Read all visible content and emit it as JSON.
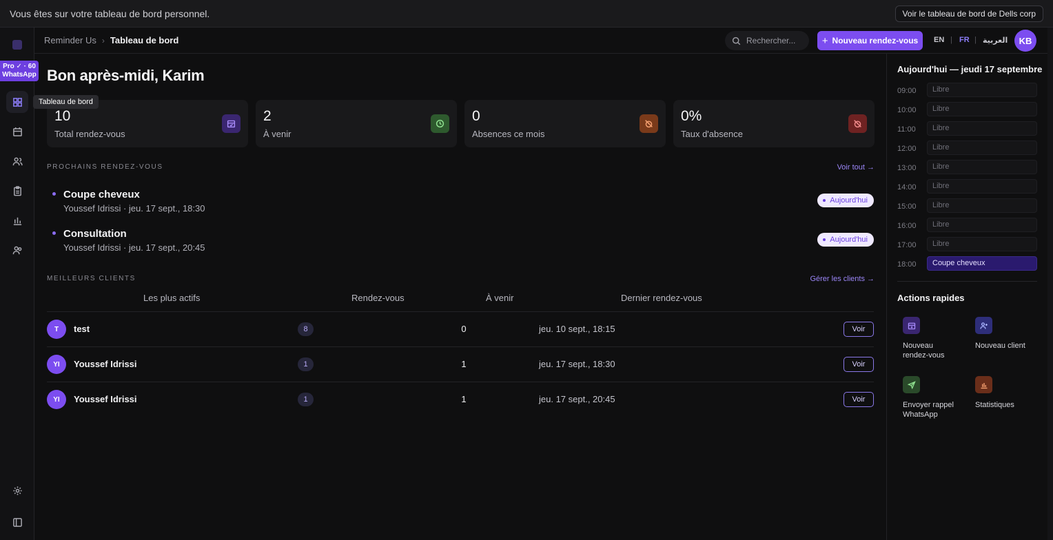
{
  "banner": {
    "text": "Vous êtes sur votre tableau de bord personnel.",
    "switch_label": "Voir le tableau de bord de Dells corp"
  },
  "sidebar": {
    "pro_badge_line1": "Pro ✓ · 60",
    "pro_badge_line2": "WhatsApp",
    "tooltip": "Tableau de bord",
    "items": [
      "dashboard-icon",
      "calendar-icon",
      "users-icon",
      "clipboard-icon",
      "bar-chart-icon",
      "team-icon",
      "gear-icon",
      "sidebar-toggle-icon"
    ]
  },
  "header": {
    "breadcrumb_root": "Reminder Us",
    "breadcrumb_sep": "›",
    "breadcrumb_current": "Tableau de bord",
    "search_placeholder": "Rechercher...",
    "new_button": "Nouveau rendez-vous",
    "langs": {
      "en": "EN",
      "fr": "FR",
      "ar": "العربية"
    },
    "avatar": "KB"
  },
  "main": {
    "greeting": "Bon après-midi, Karim",
    "stats": [
      {
        "value": "10",
        "label": "Total rendez-vous",
        "icon": "calendar-check-icon",
        "color": "#3a2670"
      },
      {
        "value": "2",
        "label": "À venir",
        "icon": "clock-icon",
        "color": "#2e5a2e"
      },
      {
        "value": "0",
        "label": "Absences ce mois",
        "icon": "alarm-off-icon",
        "color": "#7a3a1a"
      },
      {
        "value": "0%",
        "label": "Taux d'absence",
        "icon": "alarm-off-icon",
        "color": "#6e2222"
      }
    ],
    "upcoming": {
      "title": "PROCHAINS RENDEZ-VOUS",
      "link": "Voir tout →",
      "items": [
        {
          "title": "Coupe cheveux",
          "subtitle": "Youssef Idrissi · jeu. 17 sept., 18:30",
          "badge": "Aujourd'hui"
        },
        {
          "title": "Consultation",
          "subtitle": "Youssef Idrissi · jeu. 17 sept., 20:45",
          "badge": "Aujourd'hui"
        }
      ]
    },
    "clients": {
      "title": "MEILLEURS CLIENTS",
      "link": "Gérer les clients →",
      "columns": [
        "Les plus actifs",
        "Rendez-vous",
        "À venir",
        "Dernier rendez-vous"
      ],
      "rows": [
        {
          "initials": "T",
          "name": "test",
          "count": "8",
          "upcoming": "0",
          "last": "jeu. 10 sept., 18:15",
          "action": "Voir"
        },
        {
          "initials": "YI",
          "name": "Youssef Idrissi",
          "count": "1",
          "upcoming": "1",
          "last": "jeu. 17 sept., 18:30",
          "action": "Voir"
        },
        {
          "initials": "YI",
          "name": "Youssef Idrissi",
          "count": "1",
          "upcoming": "1",
          "last": "jeu. 17 sept., 20:45",
          "action": "Voir"
        }
      ]
    }
  },
  "right": {
    "title": "Aujourd'hui — jeudi 17 septembre",
    "slots": [
      {
        "time": "09:00",
        "label": "Libre"
      },
      {
        "time": "10:00",
        "label": "Libre"
      },
      {
        "time": "11:00",
        "label": "Libre"
      },
      {
        "time": "12:00",
        "label": "Libre"
      },
      {
        "time": "13:00",
        "label": "Libre"
      },
      {
        "time": "14:00",
        "label": "Libre"
      },
      {
        "time": "15:00",
        "label": "Libre"
      },
      {
        "time": "16:00",
        "label": "Libre"
      },
      {
        "time": "17:00",
        "label": "Libre"
      },
      {
        "time": "18:00",
        "label": "Coupe cheveux"
      }
    ],
    "quick_title": "Actions rapides",
    "quick": [
      {
        "label_line1": "Nouveau",
        "label_line2": "rendez-vous",
        "icon": "calendar-plus-icon",
        "color": "#3a2670"
      },
      {
        "label_line1": "Nouveau client",
        "label_line2": "",
        "icon": "user-plus-icon",
        "color": "#2e2e7a"
      },
      {
        "label_line1": "Envoyer rappel",
        "label_line2": "WhatsApp",
        "icon": "send-icon",
        "color": "#2a4a2a"
      },
      {
        "label_line1": "Statistiques",
        "label_line2": "",
        "icon": "chart-icon",
        "color": "#6a2e1a"
      }
    ]
  }
}
